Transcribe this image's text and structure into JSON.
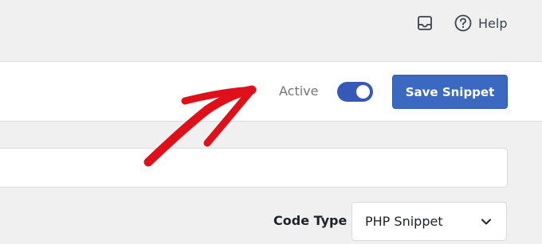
{
  "header": {
    "inbox_icon": "inbox-icon",
    "help_icon": "question-circle-icon",
    "help_label": "Help"
  },
  "snippet_bar": {
    "active_label": "Active",
    "active_toggle_on": true,
    "save_label": "Save Snippet"
  },
  "editor": {
    "title_value": "",
    "code_type_label": "Code Type",
    "code_type_selected": "PHP Snippet"
  },
  "annotation": {
    "arrow_color": "#e0101a",
    "points_to": "active-toggle"
  },
  "colors": {
    "accent": "#3b68c1",
    "toggle_on": "#3858b8",
    "page_bg": "#f0f0f1"
  }
}
